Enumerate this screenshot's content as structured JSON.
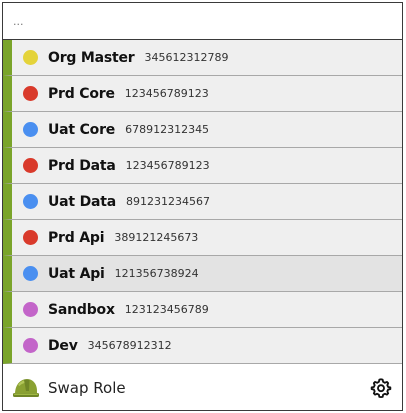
{
  "search": {
    "placeholder": "...",
    "value": ""
  },
  "roles": [
    {
      "name": "Org Master",
      "account": "345612312789",
      "color": "#e4d33a"
    },
    {
      "name": "Prd Core",
      "account": "123456789123",
      "color": "#d93a2b"
    },
    {
      "name": "Uat Core",
      "account": "678912312345",
      "color": "#4a8ff0"
    },
    {
      "name": "Prd Data",
      "account": "123456789123",
      "color": "#d93a2b"
    },
    {
      "name": "Uat Data",
      "account": "891231234567",
      "color": "#4a8ff0"
    },
    {
      "name": "Prd Api",
      "account": "389121245673",
      "color": "#d93a2b"
    },
    {
      "name": "Uat Api",
      "account": "121356738924",
      "color": "#4a8ff0"
    },
    {
      "name": "Sandbox",
      "account": "123123456789",
      "color": "#c365c9"
    },
    {
      "name": "Dev",
      "account": "345678912312",
      "color": "#c365c9"
    }
  ],
  "footer": {
    "label": "Swap Role",
    "icon": "helmet-icon",
    "settings_icon": "gear-icon"
  },
  "colors": {
    "accent_bar": "#7aa42a",
    "row_bg": "#efefef",
    "row_hover_bg": "#e3e3e3"
  }
}
